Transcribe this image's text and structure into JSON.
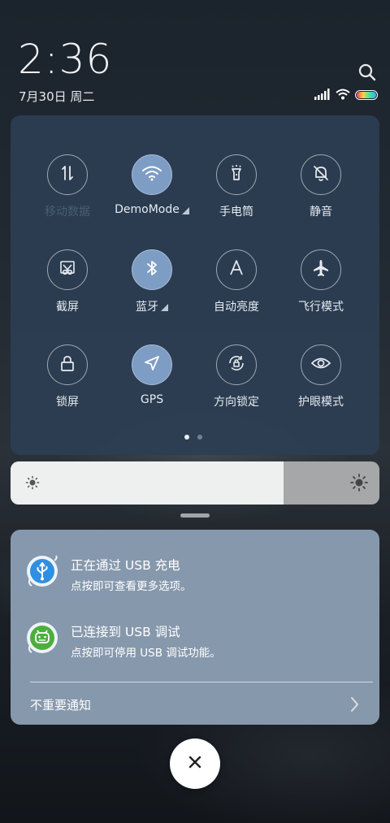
{
  "header": {
    "time": "2:36",
    "date": "7月30日 周二"
  },
  "status": {
    "icons": [
      "signal-icon",
      "wifi-icon",
      "battery-icon"
    ],
    "battery_colors": [
      "#ff3b6b",
      "#ffd33d",
      "#3ee6a0",
      "#3aa7ff"
    ]
  },
  "quick_settings": {
    "tiles": [
      {
        "id": "mobile-data",
        "label": "移动数据",
        "icon": "data-arrows-icon",
        "on": false,
        "dim": true
      },
      {
        "id": "wifi",
        "label": "DemoMode",
        "icon": "wifi-icon",
        "on": true,
        "expandable": true
      },
      {
        "id": "flashlight",
        "label": "手电筒",
        "icon": "flashlight-icon",
        "on": false
      },
      {
        "id": "mute",
        "label": "静音",
        "icon": "bell-mute-icon",
        "on": false
      },
      {
        "id": "screenshot",
        "label": "截屏",
        "icon": "scissors-icon",
        "on": false
      },
      {
        "id": "bluetooth",
        "label": "蓝牙",
        "icon": "bluetooth-icon",
        "on": true,
        "expandable": true
      },
      {
        "id": "auto-brightness",
        "label": "自动亮度",
        "icon": "auto-brightness-icon",
        "on": false
      },
      {
        "id": "airplane",
        "label": "飞行模式",
        "icon": "airplane-icon",
        "on": false
      },
      {
        "id": "lock-screen",
        "label": "锁屏",
        "icon": "lock-icon",
        "on": false
      },
      {
        "id": "gps",
        "label": "GPS",
        "icon": "location-arrow-icon",
        "on": true
      },
      {
        "id": "rotation-lock",
        "label": "方向锁定",
        "icon": "rotation-lock-icon",
        "on": false
      },
      {
        "id": "eye-care",
        "label": "护眼模式",
        "icon": "eye-icon",
        "on": false
      }
    ],
    "page_count": 2,
    "active_page": 1
  },
  "brightness": {
    "level": 0.74
  },
  "notifications": {
    "items": [
      {
        "title": "正在通过 USB 充电",
        "body": "点按即可查看更多选项。",
        "icon": "usb-icon",
        "icon_color": "#2f8fe0"
      },
      {
        "title": "已连接到 USB 调试",
        "body": "点按即可停用 USB 调试功能。",
        "icon": "android-icon",
        "icon_color": "#4caf3c"
      }
    ],
    "unimportant_label": "不重要通知"
  },
  "close": {
    "icon": "close-icon"
  }
}
